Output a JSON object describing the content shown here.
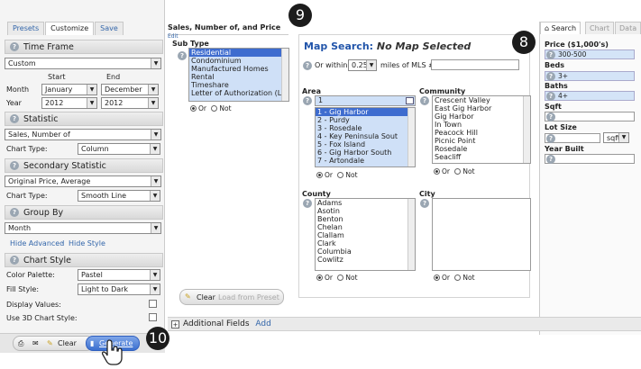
{
  "left": {
    "tabs": [
      "Presets",
      "Customize",
      "Save"
    ],
    "time_frame": {
      "title": "Time Frame",
      "preset": "Custom",
      "start_label": "Start",
      "end_label": "End",
      "month_label": "Month",
      "year_label": "Year",
      "start_month": "January",
      "end_month": "December",
      "start_year": "2012",
      "end_year": "2012"
    },
    "statistic": {
      "title": "Statistic",
      "value": "Sales, Number of",
      "chart_type_label": "Chart Type:",
      "chart_type": "Column"
    },
    "secondary": {
      "title": "Secondary Statistic",
      "value": "Original Price, Average",
      "chart_type_label": "Chart Type:",
      "chart_type": "Smooth Line"
    },
    "group_by": {
      "title": "Group By",
      "value": "Month"
    },
    "hide_advanced": "Hide Advanced",
    "separator": "·",
    "hide_style": "Hide Style",
    "chart_style": {
      "title": "Chart Style",
      "palette_label": "Color Palette:",
      "palette": "Pastel",
      "fill_label": "Fill Style:",
      "fill": "Light to Dark",
      "display_values_label": "Display Values:",
      "use_3d_label": "Use 3D Chart Style:"
    },
    "bottom": {
      "clear": "Clear",
      "generate": "Generate"
    }
  },
  "header": {
    "title": "Sales, Number of, and Price",
    "edit": "Edit"
  },
  "subtype": {
    "label": "Sub Type",
    "items": [
      "Residential",
      "Condominium",
      "Manufactured Homes",
      "Rental",
      "Timeshare",
      "Letter of Authorization (LC"
    ],
    "selected": [
      0,
      1,
      2,
      3,
      4,
      5
    ],
    "or": "Or",
    "not": "Not"
  },
  "map": {
    "title": "Map Search:",
    "subtitle": "No Map Selected",
    "or_within": "Or within",
    "miles": "0.25",
    "miles_of": "miles of MLS #",
    "area_label": "Area",
    "area_value": "1",
    "area_items": [
      "1 - Gig Harbor",
      "2 - Purdy",
      "3 - Rosedale",
      "4 - Key Peninsula Sout",
      "5 - Fox Island",
      "6 - Gig Harbor South",
      "7 - Artondale"
    ],
    "community_label": "Community",
    "community_items": [
      "Crescent Valley",
      "East Gig Harbor",
      "Gig Harbor",
      "In Town",
      "Peacock Hill",
      "Picnic Point",
      "Rosedale",
      "Seacliff"
    ],
    "county_label": "County",
    "county_items": [
      "Adams",
      "Asotin",
      "Benton",
      "Chelan",
      "Clallam",
      "Clark",
      "Columbia",
      "Cowlitz"
    ],
    "city_label": "City",
    "or": "Or",
    "not": "Not",
    "clear": "Clear",
    "load_preset": "Load from Preset"
  },
  "right": {
    "tabs": [
      "Search",
      "Chart",
      "Data"
    ],
    "price_label": "Price ($1,000's)",
    "price_value": "300-500",
    "beds_label": "Beds",
    "beds_value": "3+",
    "baths_label": "Baths",
    "baths_value": "4+",
    "sqft_label": "Sqft",
    "lot_label": "Lot Size",
    "lot_unit": "sqft",
    "year_label": "Year Built"
  },
  "additional": {
    "label": "Additional Fields",
    "add": "Add"
  },
  "badges": {
    "b9": "9",
    "b8": "8",
    "b10": "10"
  }
}
